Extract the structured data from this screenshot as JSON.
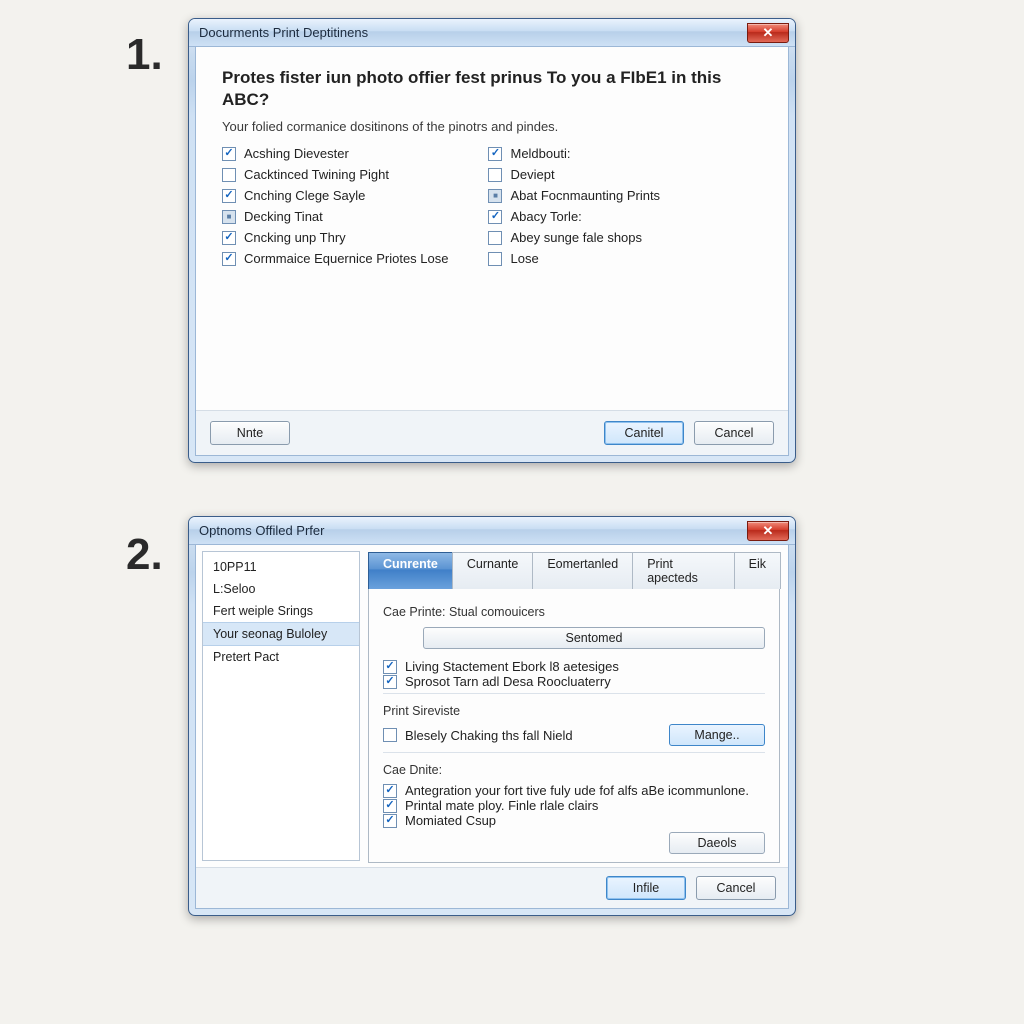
{
  "labels": {
    "one": "1.",
    "two": "2."
  },
  "dialog1": {
    "title": "Docurments Print Deptitinens",
    "heading": "Protes fister iun photo offier fest prinus To you a FIbE1 in this ABC?",
    "subtext": "Your folied cormanice dositinons of the pinotrs and pindes.",
    "col1": [
      {
        "label": "Acshing Dievester",
        "state": "checked"
      },
      {
        "label": "Cacktinced Twining Pight",
        "state": ""
      },
      {
        "label": "Cnching Clege Sayle",
        "state": "checked"
      },
      {
        "label": "Decking Tinat",
        "state": "mixed"
      },
      {
        "label": "Cncking unp Thry",
        "state": "checked"
      },
      {
        "label": "Cormmaice Equernice Priotes Lose",
        "state": "checked"
      }
    ],
    "col2": [
      {
        "label": "Meldbouti:",
        "state": "checked"
      },
      {
        "label": "Deviept",
        "state": ""
      },
      {
        "label": "Abat Focnmaunting Prints",
        "state": "mixed"
      },
      {
        "label": "Abacy Torle:",
        "state": "checked"
      },
      {
        "label": "Abey sunge fale shops",
        "state": ""
      },
      {
        "label": "Lose",
        "state": ""
      }
    ],
    "buttons": {
      "left": "Nnte",
      "primary": "Canitel",
      "cancel": "Cancel"
    }
  },
  "dialog2": {
    "title": "Optnoms Offiled Prfer",
    "sidebar": [
      {
        "label": "10PP11",
        "selected": false
      },
      {
        "label": "L:Seloo",
        "selected": false
      },
      {
        "label": "Fert weiple Srings",
        "selected": false
      },
      {
        "label": "Your seonag Buloley",
        "selected": true
      },
      {
        "label": "Pretert Pact",
        "selected": false
      }
    ],
    "tabs": [
      {
        "label": "Cunrente",
        "active": true
      },
      {
        "label": "Curnante",
        "active": false
      },
      {
        "label": "Eomertanled",
        "active": false
      },
      {
        "label": "Print apecteds",
        "active": false
      },
      {
        "label": "Eik",
        "active": false
      }
    ],
    "section1": {
      "title": "Cae Printe: Stual comouicers",
      "btn": "Sentomed",
      "checks": [
        {
          "label": "Living Stactement Ebork l8 aetesiges",
          "state": "checked"
        },
        {
          "label": "Sprosot Tarn adl Desa Roocluaterry",
          "state": "checked"
        }
      ]
    },
    "section2": {
      "title": "Print Sireviste",
      "check": {
        "label": "Blesely Chaking ths fall Nield",
        "state": ""
      },
      "btn": "Mange.."
    },
    "section3": {
      "title": "Cae Dnite:",
      "checks": [
        {
          "label": "Antegration your fort tive fuly ude fof alfs aBe icommunlone.",
          "state": "checked"
        },
        {
          "label": "Printal mate ploy. Finle rlale clairs",
          "state": "checked"
        },
        {
          "label": "Momiated Csup",
          "state": "checked"
        }
      ],
      "btn": "Daeols"
    },
    "footer": {
      "primary": "Infile",
      "cancel": "Cancel"
    }
  }
}
